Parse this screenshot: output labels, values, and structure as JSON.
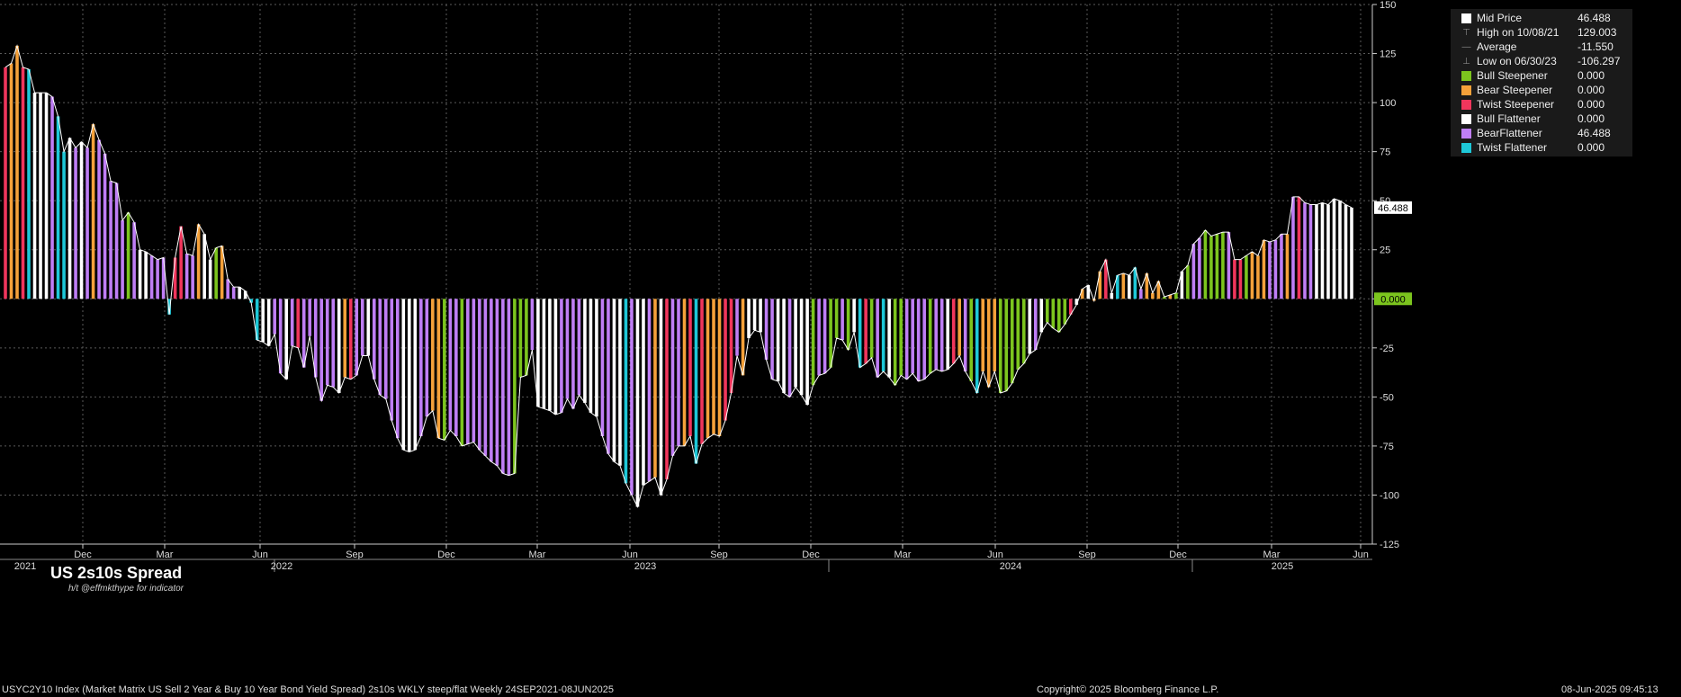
{
  "chart_data": {
    "type": "bar",
    "title": "US 2s10s Spread",
    "subtitle": "h/t @effmkthype for indicator",
    "ylim": [
      -125,
      150
    ],
    "yticks": [
      150,
      125,
      100,
      75,
      50,
      25,
      0,
      -25,
      -50,
      -75,
      -100,
      -125
    ],
    "grid": true,
    "last_value_label": "46.488",
    "zero_label": "0.000",
    "month_ticks": [
      "Dec",
      "Mar",
      "Jun",
      "Sep",
      "Dec",
      "Mar",
      "Jun",
      "Sep",
      "Dec",
      "Mar",
      "Jun",
      "Sep",
      "Dec",
      "Mar",
      "Jun"
    ],
    "years": [
      "2021",
      "2022",
      "2023",
      "2024",
      "2025"
    ],
    "regimes": {
      "BS": {
        "name": "Bull Steepener",
        "color": "#7cc51e"
      },
      "ES": {
        "name": "Bear Steepener",
        "color": "#f5a13a"
      },
      "TS": {
        "name": "Twist Steepener",
        "color": "#f0365c"
      },
      "BF": {
        "name": "Bull Flattener",
        "color": "#ffffff"
      },
      "EF": {
        "name": "BearFlattener",
        "color": "#bf7ef5"
      },
      "TF": {
        "name": "Twist Flattener",
        "color": "#1ec8d8"
      }
    },
    "values": [
      118,
      120,
      129,
      118,
      117,
      105,
      105,
      105,
      103,
      93,
      75,
      82,
      77,
      80,
      77,
      89,
      81,
      74,
      60,
      59,
      40,
      44,
      39,
      25,
      24,
      22,
      20,
      21,
      -8,
      21,
      37,
      23,
      22,
      38,
      33,
      20,
      26,
      27,
      10,
      6,
      6,
      4,
      -2,
      -21,
      -22,
      -24,
      -18,
      -38,
      -41,
      -24,
      -25,
      -35,
      -19,
      -40,
      -52,
      -44,
      -45,
      -48,
      -40,
      -41,
      -39,
      -29,
      -29,
      -41,
      -49,
      -51,
      -62,
      -71,
      -77,
      -78,
      -77,
      -70,
      -60,
      -57,
      -71,
      -72,
      -67,
      -70,
      -75,
      -74,
      -73,
      -77,
      -80,
      -83,
      -85,
      -89,
      -90,
      -89,
      -40,
      -39,
      -26,
      -55,
      -56,
      -57,
      -59,
      -58,
      -51,
      -56,
      -49,
      -53,
      -58,
      -60,
      -70,
      -79,
      -83,
      -85,
      -94,
      -100,
      -106,
      -95,
      -93,
      -91,
      -100,
      -92,
      -80,
      -75,
      -75,
      -70,
      -84,
      -74,
      -71,
      -69,
      -70,
      -62,
      -48,
      -29,
      -39,
      -20,
      -16,
      -17,
      -31,
      -41,
      -42,
      -48,
      -50,
      -45,
      -49,
      -54,
      -44,
      -39,
      -38,
      -35,
      -20,
      -21,
      -26,
      -17,
      -35,
      -33,
      -30,
      -40,
      -37,
      -40,
      -44,
      -39,
      -41,
      -38,
      -42,
      -41,
      -38,
      -36,
      -37,
      -36,
      -33,
      -29,
      -37,
      -42,
      -48,
      -37,
      -45,
      -37,
      -48,
      -47,
      -43,
      -36,
      -33,
      -28,
      -26,
      -17,
      -12,
      -15,
      -17,
      -13,
      -8,
      -3,
      5,
      7,
      -1,
      14,
      20,
      3,
      12,
      13,
      12,
      16,
      5,
      13,
      3,
      9,
      1,
      2,
      3,
      14,
      17,
      28,
      31,
      35,
      32,
      33,
      34,
      34,
      20,
      20,
      22,
      24,
      22,
      30,
      29,
      30,
      33,
      33,
      52,
      52,
      49,
      48,
      48,
      49,
      48,
      51,
      50,
      48,
      46.488
    ],
    "colors": [
      "TS",
      "ES",
      "ES",
      "TS",
      "TF",
      "BF",
      "BF",
      "BF",
      "EF",
      "TF",
      "TF",
      "BF",
      "EF",
      "BF",
      "EF",
      "ES",
      "EF",
      "EF",
      "EF",
      "EF",
      "EF",
      "BS",
      "EF",
      "BF",
      "BF",
      "EF",
      "EF",
      "EF",
      "TF",
      "TS",
      "TS",
      "EF",
      "EF",
      "ES",
      "BF",
      "BF",
      "BS",
      "ES",
      "EF",
      "EF",
      "BF",
      "BF",
      "TF",
      "TF",
      "BF",
      "BF",
      "EF",
      "EF",
      "BF",
      "EF",
      "TS",
      "EF",
      "EF",
      "EF",
      "EF",
      "EF",
      "EF",
      "BF",
      "ES",
      "TS",
      "EF",
      "EF",
      "BF",
      "EF",
      "EF",
      "EF",
      "EF",
      "EF",
      "BF",
      "BF",
      "BF",
      "EF",
      "EF",
      "ES",
      "ES",
      "BS",
      "EF",
      "EF",
      "BS",
      "EF",
      "EF",
      "EF",
      "EF",
      "EF",
      "EF",
      "EF",
      "EF",
      "BS",
      "BS",
      "BS",
      "EF",
      "BF",
      "BF",
      "BF",
      "BF",
      "EF",
      "EF",
      "EF",
      "EF",
      "BF",
      "BF",
      "BF",
      "EF",
      "EF",
      "BF",
      "BF",
      "TF",
      "EF",
      "BF",
      "BF",
      "EF",
      "ES",
      "BF",
      "TS",
      "EF",
      "EF",
      "ES",
      "TS",
      "TF",
      "TS",
      "ES",
      "ES",
      "ES",
      "TS",
      "TS",
      "EF",
      "ES",
      "BF",
      "BF",
      "BF",
      "EF",
      "EF",
      "BF",
      "BF",
      "EF",
      "BF",
      "BF",
      "BF",
      "BS",
      "EF",
      "EF",
      "BS",
      "BS",
      "EF",
      "BS",
      "BF",
      "TF",
      "TS",
      "BS",
      "EF",
      "TF",
      "BF",
      "BS",
      "BS",
      "EF",
      "EF",
      "EF",
      "EF",
      "BS",
      "EF",
      "EF",
      "BF",
      "TS",
      "ES",
      "EF",
      "BS",
      "TF",
      "ES",
      "ES",
      "ES",
      "BS",
      "BS",
      "BS",
      "BS",
      "BS",
      "BF",
      "EF",
      "BF",
      "BS",
      "BS",
      "BS",
      "BS",
      "TS",
      "BF",
      "ES",
      "BF",
      "ES",
      "ES",
      "TS",
      "BF",
      "TF",
      "ES",
      "BF",
      "TF",
      "EF",
      "ES",
      "ES",
      "ES",
      "BS",
      "ES",
      "BS",
      "BF",
      "BS",
      "EF",
      "EF",
      "BS",
      "BS",
      "BS",
      "BS",
      "EF",
      "TS",
      "TS",
      "BS",
      "ES",
      "ES",
      "ES",
      "EF",
      "EF",
      "EF",
      "ES",
      "EF",
      "TS",
      "EF",
      "EF"
    ]
  },
  "legend": [
    {
      "kind": "square",
      "color": "#ffffff",
      "label": "Mid Price",
      "value": "46.488"
    },
    {
      "kind": "high",
      "label": "High on 10/08/21",
      "value": "129.003"
    },
    {
      "kind": "avg",
      "label": "Average",
      "value": "-11.550"
    },
    {
      "kind": "low",
      "label": "Low on 06/30/23",
      "value": "-106.297"
    },
    {
      "kind": "square",
      "color": "#7cc51e",
      "label": "Bull Steepener",
      "value": "0.000"
    },
    {
      "kind": "square",
      "color": "#f5a13a",
      "label": "Bear Steepener",
      "value": "0.000"
    },
    {
      "kind": "square",
      "color": "#f0365c",
      "label": "Twist Steepener",
      "value": "0.000"
    },
    {
      "kind": "square",
      "color": "#ffffff",
      "label": "Bull Flattener",
      "value": "0.000"
    },
    {
      "kind": "square",
      "color": "#bf7ef5",
      "label": "BearFlattener",
      "value": "46.488"
    },
    {
      "kind": "square",
      "color": "#1ec8d8",
      "label": "Twist Flattener",
      "value": "0.000"
    }
  ],
  "footer": {
    "description": "USYC2Y10 Index (Market Matrix US Sell 2 Year & Buy 10 Year Bond Yield Spread) 2s10s WKLY steep/flat  Weekly 24SEP2021-08JUN2025",
    "copyright": "Copyright© 2025 Bloomberg Finance L.P.",
    "timestamp": "08-Jun-2025 09:45:13"
  }
}
